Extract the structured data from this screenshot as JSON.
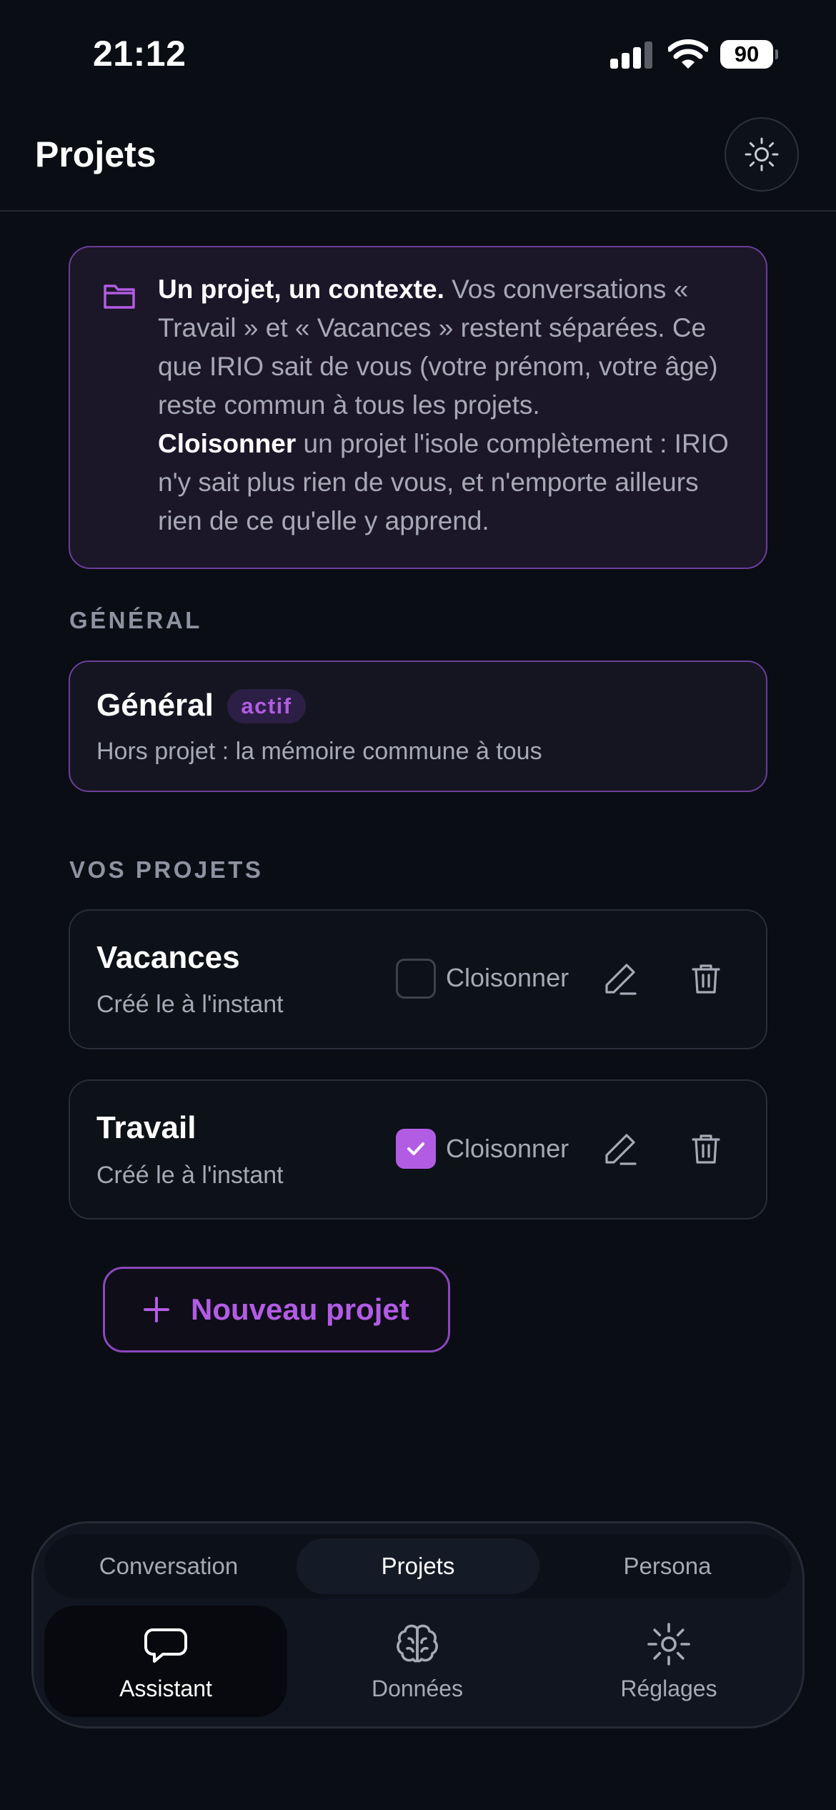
{
  "status_bar": {
    "time": "21:12",
    "battery": "90"
  },
  "header": {
    "title": "Projets",
    "theme_icon": "sun-icon"
  },
  "info": {
    "icon": "folder-icon",
    "lead_bold": "Un projet, un contexte.",
    "lead_text": " Vos conversations « Travail » et « Vacances » restent séparées. Ce que IRIO sait de vous (votre prénom, votre âge) reste commun à tous les projets.",
    "second_bold": "Cloisonner",
    "second_text": " un projet l'isole complètement : IRIO n'y sait plus rien de vous, et n'emporte ailleurs rien de ce qu'elle y apprend."
  },
  "general_section": {
    "label": "GÉNÉRAL",
    "card": {
      "title": "Général",
      "badge": "actif",
      "subtitle": "Hors projet : la mémoire commune à tous"
    }
  },
  "projects_section": {
    "label": "VOS PROJETS",
    "projects": [
      {
        "name": "Vacances",
        "created": "Créé le à l'instant",
        "isolate_label": "Cloisonner",
        "isolated": false
      },
      {
        "name": "Travail",
        "created": "Créé le à l'instant",
        "isolate_label": "Cloisonner",
        "isolated": true
      }
    ],
    "new_button": "Nouveau projet"
  },
  "bottom_nav": {
    "segments": [
      {
        "label": "Conversation",
        "active": false
      },
      {
        "label": "Projets",
        "active": true
      },
      {
        "label": "Persona",
        "active": false
      }
    ],
    "tabs": [
      {
        "label": "Assistant",
        "icon": "chat-bubble-icon",
        "active": true
      },
      {
        "label": "Données",
        "icon": "brain-icon",
        "active": false
      },
      {
        "label": "Réglages",
        "icon": "gear-icon",
        "active": false
      }
    ]
  },
  "colors": {
    "background": "#0a0d14",
    "accent": "#b25ce4",
    "accent_border": "#6a3f98",
    "muted_text": "#a7a9b5"
  }
}
